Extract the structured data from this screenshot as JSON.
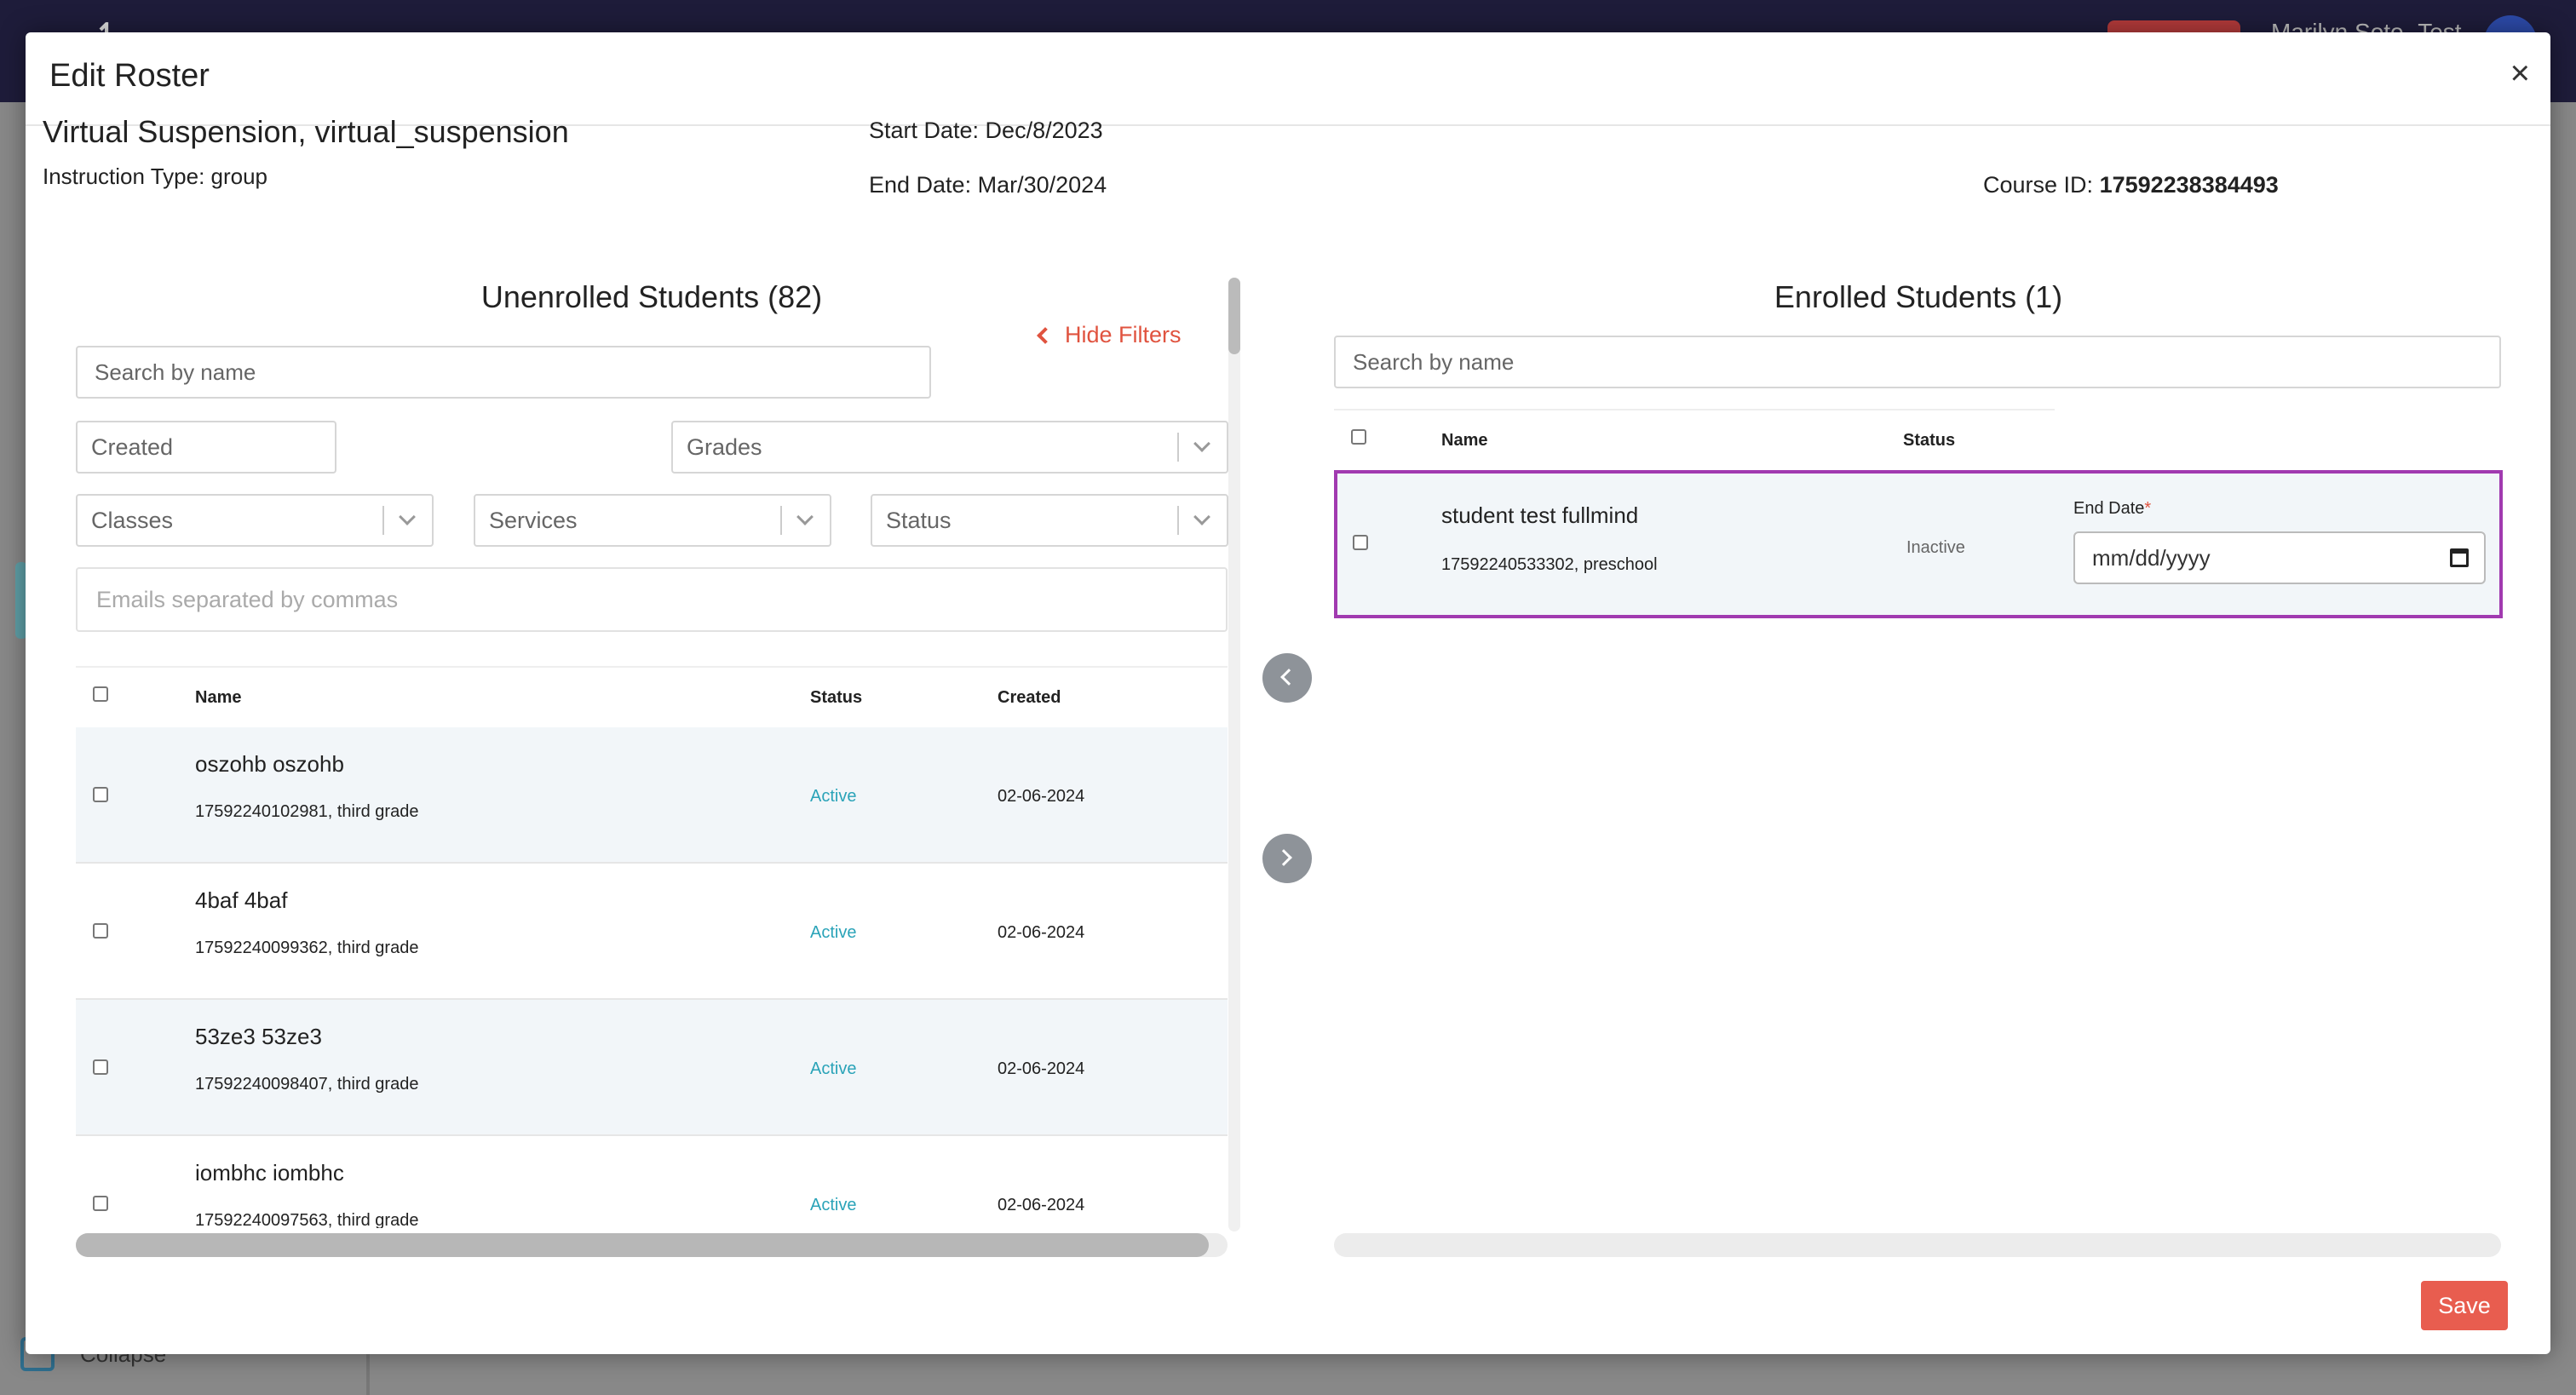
{
  "background": {
    "user_name": "Marilyn Soto- Test",
    "collapse_label": "Collapse"
  },
  "modal": {
    "title": "Edit Roster",
    "close_glyph": "×",
    "course_name": "Virtual Suspension, virtual_suspension",
    "instruction_type": "Instruction Type: group",
    "start_date": "Start Date: Dec/8/2023",
    "end_date": "End Date: Mar/30/2024",
    "course_id_label": "Course ID:",
    "course_id": "17592238384493",
    "save_label": "Save"
  },
  "unenrolled": {
    "title": "Unenrolled Students (82)",
    "search_placeholder": "Search by name",
    "hide_filters_label": "Hide Filters",
    "filters": {
      "created": "Created",
      "grades": "Grades",
      "classes": "Classes",
      "services": "Services",
      "status": "Status",
      "emails_placeholder": "Emails separated by commas"
    },
    "columns": {
      "name": "Name",
      "status": "Status",
      "created": "Created"
    },
    "rows": [
      {
        "name": "oszohb oszohb",
        "sub": "17592240102981, third grade",
        "status": "Active",
        "created": "02-06-2024"
      },
      {
        "name": "4baf 4baf",
        "sub": "17592240099362, third grade",
        "status": "Active",
        "created": "02-06-2024"
      },
      {
        "name": "53ze3 53ze3",
        "sub": "17592240098407, third grade",
        "status": "Active",
        "created": "02-06-2024"
      },
      {
        "name": "iombhc iombhc",
        "sub": "17592240097563, third grade",
        "status": "Active",
        "created": "02-06-2024"
      }
    ]
  },
  "enrolled": {
    "title": "Enrolled Students (1)",
    "search_placeholder": "Search by name",
    "columns": {
      "name": "Name",
      "status": "Status"
    },
    "rows": [
      {
        "name": "student test fullmind",
        "sub": "17592240533302, preschool",
        "status": "Inactive",
        "end_date_label": "End Date",
        "end_date_required": "*",
        "end_date_placeholder": "mm/dd/yyyy"
      }
    ]
  },
  "colors": {
    "accent_red": "#e85d4f",
    "active_status": "#2aa3b8",
    "selection_border": "#a13ab0"
  }
}
